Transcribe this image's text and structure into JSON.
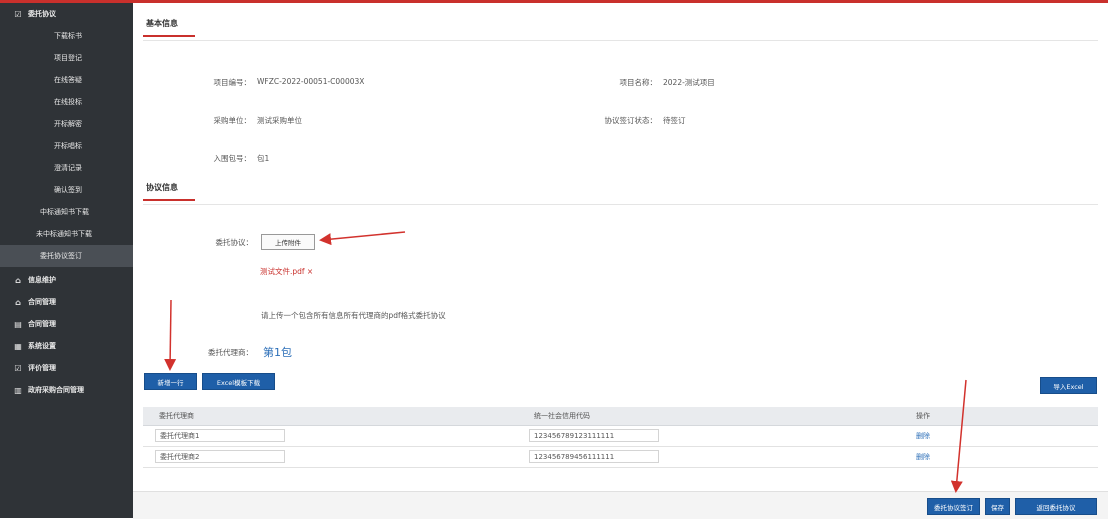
{
  "sidebar": {
    "items": [
      {
        "label": "委托协议",
        "type": "top",
        "icon": "checkbox-icon"
      },
      {
        "label": "下载标书",
        "type": "sub"
      },
      {
        "label": "项目登记",
        "type": "sub"
      },
      {
        "label": "在线答疑",
        "type": "sub"
      },
      {
        "label": "在线投标",
        "type": "sub"
      },
      {
        "label": "开标解密",
        "type": "sub"
      },
      {
        "label": "开标唱标",
        "type": "sub"
      },
      {
        "label": "澄清记录",
        "type": "sub"
      },
      {
        "label": "确认签到",
        "type": "sub"
      },
      {
        "label": "中标通知书下载",
        "type": "sub"
      },
      {
        "label": "未中标通知书下载",
        "type": "sub"
      },
      {
        "label": "委托协议签订",
        "type": "sub",
        "active": true
      },
      {
        "label": "信息维护",
        "type": "top",
        "icon": "home-icon"
      },
      {
        "label": "合同管理",
        "type": "top",
        "icon": "home-icon"
      },
      {
        "label": "合同管理",
        "type": "top",
        "icon": "document-icon"
      },
      {
        "label": "系统设置",
        "type": "top",
        "icon": "grid-icon"
      },
      {
        "label": "评价管理",
        "type": "top",
        "icon": "checkbox-icon"
      },
      {
        "label": "政府采购合同管理",
        "type": "top",
        "icon": "table-icon"
      }
    ]
  },
  "basic": {
    "title": "基本信息",
    "project_no_label": "项目编号：",
    "project_no": "WFZC-2022-00051-C00003X",
    "project_name_label": "项目名称：",
    "project_name": "2022-测试项目",
    "purchaser_label": "采购单位：",
    "purchaser": "测试采购单位",
    "sign_status_label": "协议签订状态：",
    "sign_status": "待签订",
    "entry_label": "入围包号：",
    "entry": "包1"
  },
  "protocol": {
    "title": "协议信息",
    "agreement_label": "委托协议：",
    "upload_button": "上传附件",
    "file_name": "测试文件.pdf ×",
    "hint": "请上传一个包含所有信息所有代理商的pdf格式委托协议",
    "agent_pkg_label": "委托代理商：",
    "agent_pkg_value": "第1包"
  },
  "actions": {
    "add_row": "新增一行",
    "excel_template": "Excel模板下载",
    "import_excel": "导入Excel"
  },
  "table": {
    "headers": [
      "委托代理商",
      "统一社会信用代码",
      "操作"
    ],
    "rows": [
      {
        "name": "委托代理商1",
        "code": "123456789123111111",
        "op": "删除"
      },
      {
        "name": "委托代理商2",
        "code": "123456789456111111",
        "op": "删除"
      }
    ]
  },
  "footer": {
    "sign_button": "委托协议签订",
    "save_button": "保存",
    "back_button": "返回委托协议"
  },
  "colors": {
    "sidebar_bg": "#2f3337",
    "accent_red": "#c9302c",
    "primary_blue": "#1f5fa8"
  }
}
